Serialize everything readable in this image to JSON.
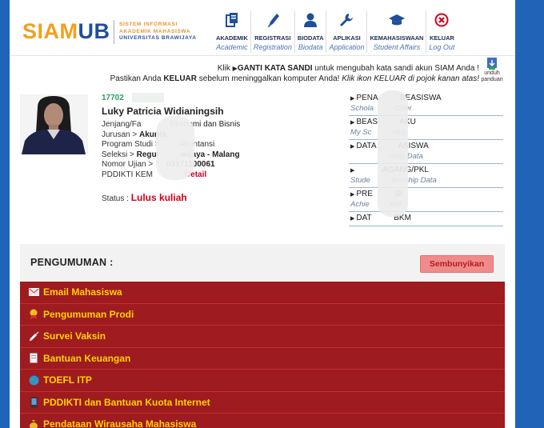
{
  "header": {
    "logo_siam": "SIAM",
    "logo_ub": "UB",
    "logo_line1": "SISTEM INFORMASI",
    "logo_line2": "AKADEMIK MAHASISWA",
    "logo_line3": "UNIVERSITAS BRAWIJAYA",
    "nav": [
      {
        "label": "AKADEMIK",
        "sub": "Academic",
        "icon": "document-icon"
      },
      {
        "label": "REGISTRASI",
        "sub": "Registration",
        "icon": "pen-icon"
      },
      {
        "label": "BIODATA",
        "sub": "Biodata",
        "icon": "person-icon"
      },
      {
        "label": "APLIKASI",
        "sub": "Application",
        "icon": "wrench-icon"
      },
      {
        "label": "KEMAHASISWAAN",
        "sub": "Student Affairs",
        "icon": "graduation-cap-icon"
      },
      {
        "label": "KELUAR",
        "sub": "Log Out",
        "icon": "close-circle-icon"
      }
    ]
  },
  "notice": {
    "line1_pre": "Klik ",
    "line1_bold": "GANTI KATA SANDI",
    "line1_post": " untuk mengubah kata sandi akun SIAM Anda !",
    "line2_pre": "Pastikan Anda ",
    "line2_bold": "KELUAR",
    "line2_mid": " sebelum meninggalkan komputer Anda! ",
    "line2_italic": "Klik ikon KELUAR di pojok kanan atas!",
    "download_line1": "unduh",
    "download_line2": "panduan"
  },
  "profile": {
    "nim": "17702",
    "name": "Luky Patricia Widianingsih",
    "lines": [
      {
        "label": "Jenjang/Fa",
        "value": "Ekonomi dan Bisnis"
      },
      {
        "label": "Jurusan > ",
        "value": "Akunta"
      },
      {
        "label": "Program Studi > ",
        "value": "Akuntansi"
      },
      {
        "label": "Seleksi > ",
        "value": "Regul          wijaya - Malang"
      },
      {
        "label": "Nomor Ujian > ",
        "value": "03171100061"
      },
      {
        "label": "PDDIKTI KEM",
        "value": ""
      }
    ],
    "detail_link": "Detail",
    "status_label": "Status : ",
    "status_value": "Lulus kuliah"
  },
  "menu": [
    {
      "title": "PENA          BEASISWA",
      "sub": "Schola          Offer"
    },
    {
      "title": "BEAS          AKU",
      "sub": "My Sc          ship"
    },
    {
      "title": "DATA          ASISWA",
      "sub": "                  rship Data"
    },
    {
      "title": "            AGANG/PKL",
      "sub": "Stude          ternship Data"
    },
    {
      "title": "PRE          SI",
      "sub": "Achie          ent"
    },
    {
      "title": "DAT          BKM",
      "sub": ""
    }
  ],
  "announcement": {
    "title": "PENGUMUMAN :",
    "hide_button": "Sembunyikan",
    "items": [
      {
        "label": "Email Mahasiswa",
        "icon": "envelope-icon"
      },
      {
        "label": "Pengumuman Prodi",
        "icon": "certificate-icon"
      },
      {
        "label": "Survei Vaksin",
        "icon": "syringe-icon"
      },
      {
        "label": "Bantuan Keuangan",
        "icon": "document-icon"
      },
      {
        "label": "TOEFL ITP",
        "icon": "globe-icon"
      },
      {
        "label": "PDDIKTI dan Bantuan Kuota Internet",
        "icon": "phone-icon"
      },
      {
        "label": "Pendataan Wirausaha Mahasiswa",
        "icon": "moneybag-icon"
      }
    ]
  },
  "colors": {
    "page_bg": "#2163b6",
    "accent_orange": "#f0a020",
    "brand_blue": "#1f4f9a",
    "announcement_red": "#9e1b1f",
    "announcement_text": "#ffd200",
    "status_red": "#d2001a"
  }
}
